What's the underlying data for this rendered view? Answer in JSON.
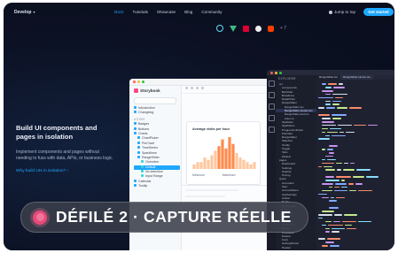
{
  "nav": {
    "brand": "Develop",
    "links": [
      "Docs",
      "Tutorials",
      "Showcase",
      "Blog",
      "Community"
    ],
    "active_index": 0,
    "jump": "Jump to top",
    "cta": "Get started"
  },
  "frameworks": [
    "react-icon",
    "vue-icon",
    "angular-icon",
    "web-components-icon",
    "html-icon",
    "more"
  ],
  "frameworks_more": "+ 7",
  "hero": {
    "title": "Build UI components and pages in isolation",
    "body": "Implement components and pages without needing to fuss with data, APIs, or business logic.",
    "link": "Why build UIs in isolation?"
  },
  "storybook": {
    "logo": "Storybook",
    "tree": [
      {
        "label": "Introduction",
        "kind": "doc"
      },
      {
        "label": "Changelog",
        "kind": "doc"
      },
      {
        "label": "ATOMS",
        "kind": "header"
      },
      {
        "label": "Badges",
        "kind": "comp"
      },
      {
        "label": "Buttons",
        "kind": "comp"
      },
      {
        "label": "Charts",
        "kind": "comp"
      },
      {
        "label": "ChartPicker",
        "kind": "comp"
      },
      {
        "label": "PieChart",
        "kind": "comp"
      },
      {
        "label": "TimeSeries",
        "kind": "comp"
      },
      {
        "label": "Sparklines",
        "kind": "comp"
      },
      {
        "label": "RangeSlider",
        "kind": "comp"
      },
      {
        "label": "Overview",
        "kind": "story"
      },
      {
        "label": "Default",
        "kind": "story",
        "selected": true
      },
      {
        "label": "No selection",
        "kind": "story"
      },
      {
        "label": "Input Range",
        "kind": "story"
      },
      {
        "label": "Calendar",
        "kind": "comp"
      },
      {
        "label": "Tooltip",
        "kind": "comp"
      }
    ],
    "card": {
      "title": "Average visits per hour",
      "stat1": "Minimum",
      "stat2": "Maximum",
      "histogram": [
        2,
        3,
        3,
        5,
        4,
        6,
        8,
        10,
        13,
        9,
        14,
        11,
        7,
        5,
        4,
        3,
        2,
        3
      ]
    }
  },
  "editor": {
    "section": "EXPLORER",
    "tabs": [
      "RangeSlider.tsx",
      "RangeSlider.stories.tsx"
    ],
    "files": [
      {
        "label": "src",
        "indent": 0
      },
      {
        "label": "components",
        "indent": 1
      },
      {
        "label": "BarChart",
        "indent": 1
      },
      {
        "label": "BrandLine",
        "indent": 1
      },
      {
        "label": "DatePicker",
        "indent": 1
      },
      {
        "label": "RangeSlider",
        "indent": 1
      },
      {
        "label": "RangeSlider.tsx",
        "indent": 2
      },
      {
        "label": "RangeSlider.stories.tsx",
        "indent": 2,
        "highlight": true
      },
      {
        "label": "RangeSlider.test.tsx",
        "indent": 2
      },
      {
        "label": "index.ts",
        "indent": 2
      },
      {
        "label": "Sparkline",
        "indent": 1
      },
      {
        "label": "Sparklines",
        "indent": 1
      },
      {
        "label": "ProgressIndicator",
        "indent": 1
      },
      {
        "label": "PieChart",
        "indent": 1
      },
      {
        "label": "RangeSlider",
        "indent": 1
      },
      {
        "label": "SlideOut",
        "indent": 1
      },
      {
        "label": "Tooltip",
        "indent": 1
      },
      {
        "label": "Toggle",
        "indent": 1
      },
      {
        "label": "Tabs",
        "indent": 1
      },
      {
        "label": "Models",
        "indent": 1
      },
      {
        "label": "pages",
        "indent": 0
      },
      {
        "label": "Dashboard",
        "indent": 1
      },
      {
        "label": "Settings",
        "indent": 1
      },
      {
        "label": "Sidebar",
        "indent": 1
      },
      {
        "label": "Pricing",
        "indent": 1
      },
      {
        "label": "styles",
        "indent": 0
      },
      {
        "label": "Accordion",
        "indent": 1
      },
      {
        "label": "Alert",
        "indent": 1
      },
      {
        "label": "AccountMenu",
        "indent": 1
      },
      {
        "label": "AppSettings",
        "indent": 1
      },
      {
        "label": "Avatar",
        "indent": 1
      },
      {
        "label": "Badge",
        "indent": 1
      },
      {
        "label": "Breadcrumb",
        "indent": 1
      },
      {
        "label": "Button",
        "indent": 1
      },
      {
        "label": "Calendar",
        "indent": 1
      },
      {
        "label": "Card",
        "indent": 1
      },
      {
        "label": "Checkbox",
        "indent": 1
      },
      {
        "label": "Combobox",
        "indent": 1
      },
      {
        "label": "Dialog",
        "indent": 1
      },
      {
        "label": "Dropdown",
        "indent": 1
      },
      {
        "label": "Drawer",
        "indent": 1
      },
      {
        "label": "Form",
        "indent": 1
      },
      {
        "label": "SettingsPanel",
        "indent": 1
      },
      {
        "label": "Header",
        "indent": 1
      },
      {
        "label": "TableBlock",
        "indent": 1
      }
    ]
  },
  "overlay": {
    "label": "DÉFILÉ 2 · CAPTURE RÉELLE",
    "accent": "#e84a7a"
  }
}
